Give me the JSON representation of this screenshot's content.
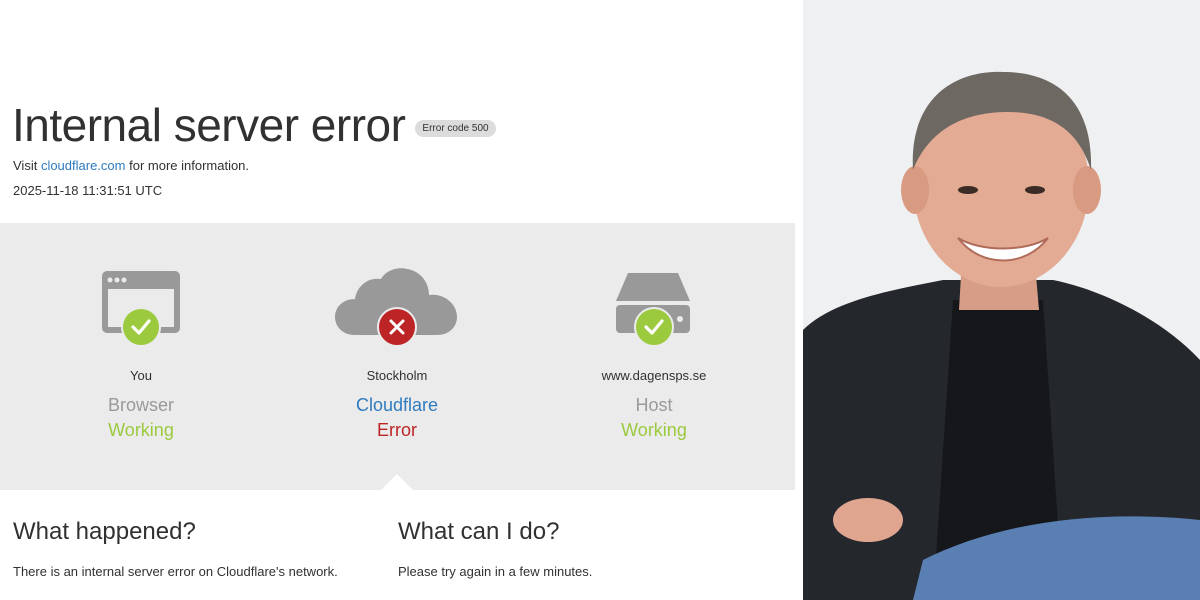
{
  "error": {
    "title": "Internal server error",
    "badge": "Error code 500",
    "visit_prefix": "Visit ",
    "visit_link": "cloudflare.com",
    "visit_suffix": " for more information.",
    "timestamp": "2025-11-18 11:31:51 UTC"
  },
  "diagram": {
    "nodes": [
      {
        "location": "You",
        "name": "Browser",
        "status": "Working",
        "state": "ok"
      },
      {
        "location": "Stockholm",
        "name": "Cloudflare",
        "status": "Error",
        "state": "error"
      },
      {
        "location": "www.dagensps.se",
        "name": "Host",
        "status": "Working",
        "state": "ok"
      }
    ]
  },
  "what_happened": {
    "heading": "What happened?",
    "text": "There is an internal server error on Cloudflare's network."
  },
  "what_can_i_do": {
    "heading": "What can I do?",
    "text": "Please try again in a few minutes."
  },
  "colors": {
    "ok": "#9bca3e",
    "error": "#bd2426",
    "link": "#2f7bbf",
    "band": "#ebebeb"
  }
}
